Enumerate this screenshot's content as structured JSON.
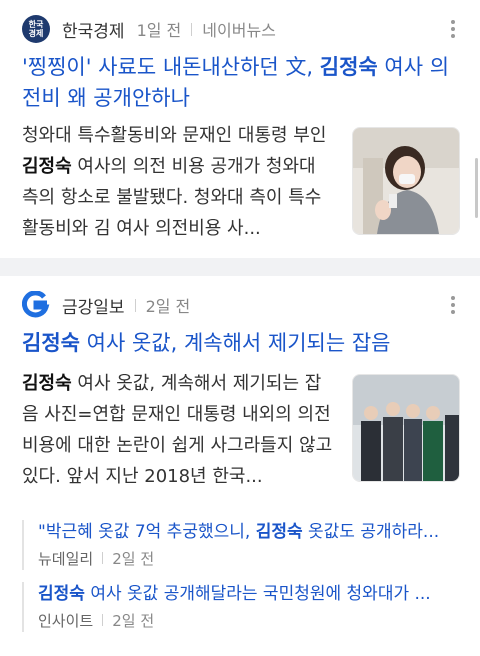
{
  "card1": {
    "source": "한국경제",
    "logo_text": "한국\n경제",
    "time": "1일 전",
    "channel": "네이버뉴스",
    "headline_pre": "'찡찡이' 사료도 내돈내산하던 文, ",
    "headline_hl": "김정숙",
    "headline_post": " 여사 의전비 왜 공개안하나",
    "summary_pre": "청와대 특수활동비와 문재인 대통령 부인 ",
    "summary_hl": "김정숙",
    "summary_post": " 여사의 의전 비용 공개가 청와대 측의 항소로 불발됐다. 청와대 측이 특수활동비와 김 여사 의전비용 사..."
  },
  "card2": {
    "source": "금강일보",
    "time": "2일 전",
    "headline_hl": "김정숙",
    "headline_post": " 여사 옷값, 계속해서 제기되는 잡음",
    "summary_hl": "김정숙",
    "summary_post": " 여사 옷값, 계속해서 제기되는 잡음 사진=연합 문재인 대통령 내외의 의전 비용에 대한 논란이 쉽게 사그라들지 않고 있다. 앞서 지난 2018년 한국...",
    "related": [
      {
        "title_pre": "\"박근혜 옷값 7억 추궁했으니, ",
        "title_hl": "김정숙",
        "title_post": " 옷값도 공개하라...",
        "source": "뉴데일리",
        "time": "2일 전"
      },
      {
        "title_pre": "",
        "title_hl": "김정숙",
        "title_post": " 여사 옷값 공개해달라는 국민청원에 청와대가 ...",
        "source": "인사이트",
        "time": "2일 전"
      }
    ]
  },
  "colors": {
    "link": "#1a55c9",
    "separator": "#f1f2f4",
    "logo_hk": "#1e3a6e"
  }
}
